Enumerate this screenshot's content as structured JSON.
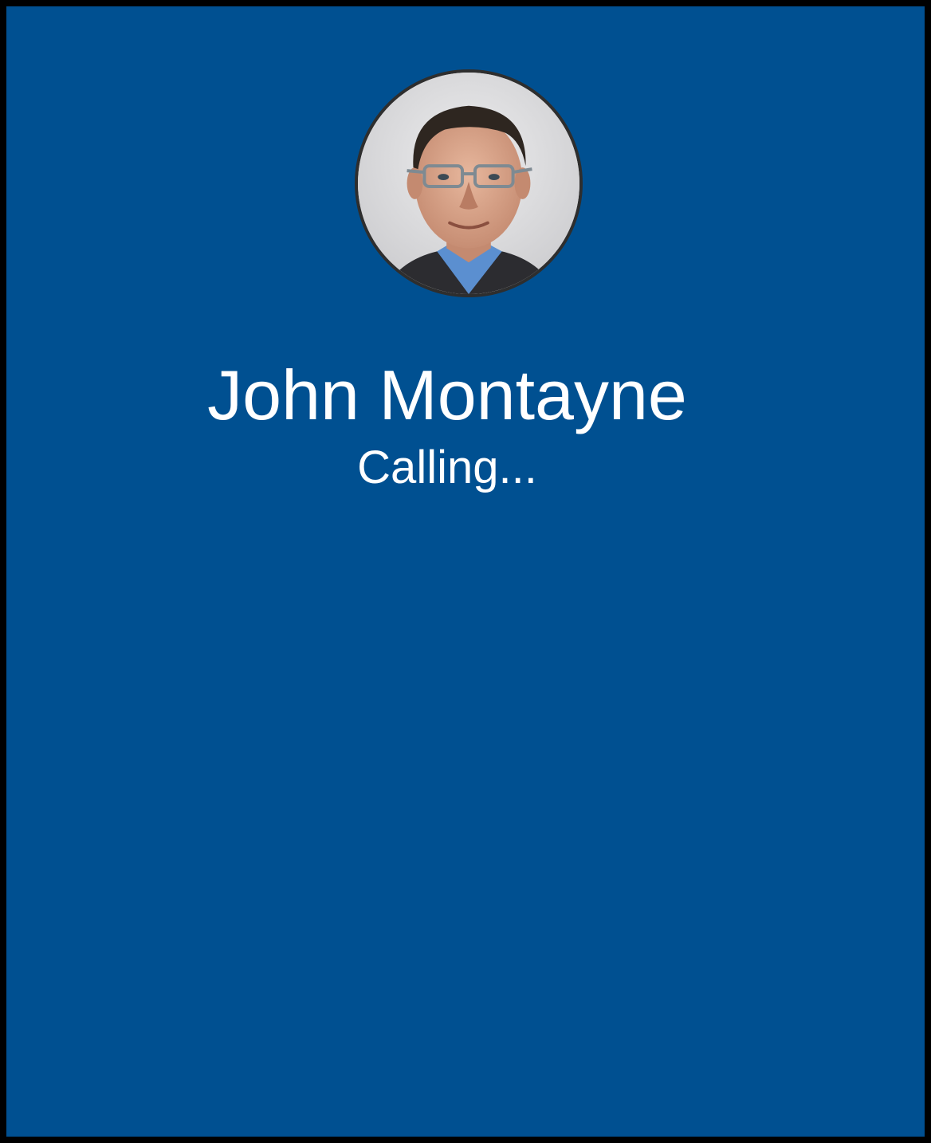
{
  "caller": {
    "name": "John Montayne",
    "status": "Calling...",
    "avatar_icon": "contact-photo"
  },
  "colors": {
    "background": "#005091",
    "frame": "#000000",
    "text": "#ffffff",
    "avatar_border": "#2e2e2e"
  }
}
